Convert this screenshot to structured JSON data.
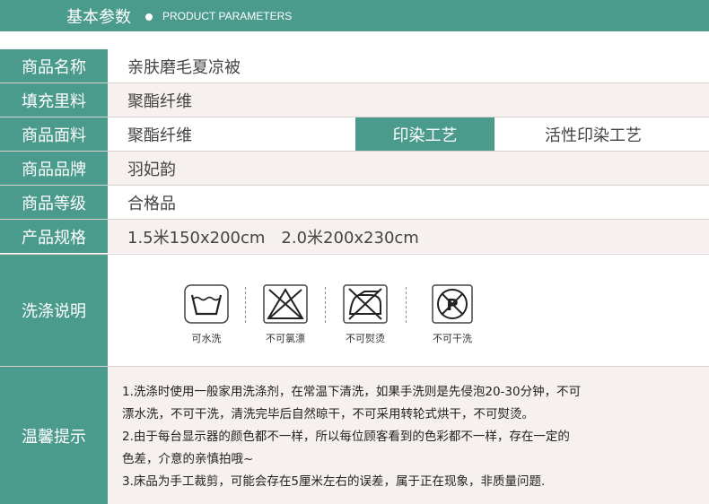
{
  "header": {
    "title": "基本参数",
    "subtitle": "PRODUCT PARAMETERS"
  },
  "rows": [
    {
      "label": "商品名称",
      "value": "亲肤磨毛夏凉被"
    },
    {
      "label": "填充里料",
      "value": "聚酯纤维"
    },
    {
      "label": "商品面料",
      "value": "聚酯纤维"
    },
    {
      "label": "商品品牌",
      "value": "羽妃韵"
    },
    {
      "label": "商品等级",
      "value": "合格品"
    },
    {
      "label": "产品规格",
      "value": "1.5米150x200cm　2.0米200x230cm"
    }
  ],
  "craft": {
    "label": "印染工艺",
    "value": "活性印染工艺"
  },
  "care": {
    "label": "洗涤说明",
    "items": [
      {
        "icon": "washable-icon",
        "text": "可水洗"
      },
      {
        "icon": "no-bleach-icon",
        "text": "不可氯漂"
      },
      {
        "icon": "no-iron-icon",
        "text": "不可熨烫"
      },
      {
        "icon": "no-dry-clean-icon",
        "text": "不可干洗"
      }
    ]
  },
  "tips": {
    "label": "温馨提示",
    "lines": [
      "1.洗涤时使用一般家用洗涤剂，在常温下清洗，如果手洗则是先侵泡20-30分钟，不可",
      "漂水洗，不可干洗，清洗完毕后自然晾干，不可采用转轮式烘干，不可熨烫。",
      "2.由于每台显示器的颜色都不一样，所以每位顾客看到的色彩都不一样，存在一定的",
      "色差，介意的亲慎拍哦~",
      "3.床品为手工裁剪，可能会存在5厘米左右的误差，属于正在现象，非质量问题."
    ]
  },
  "colors": {
    "accent": "#4a9b8b",
    "shade": "#f6f1ef"
  }
}
